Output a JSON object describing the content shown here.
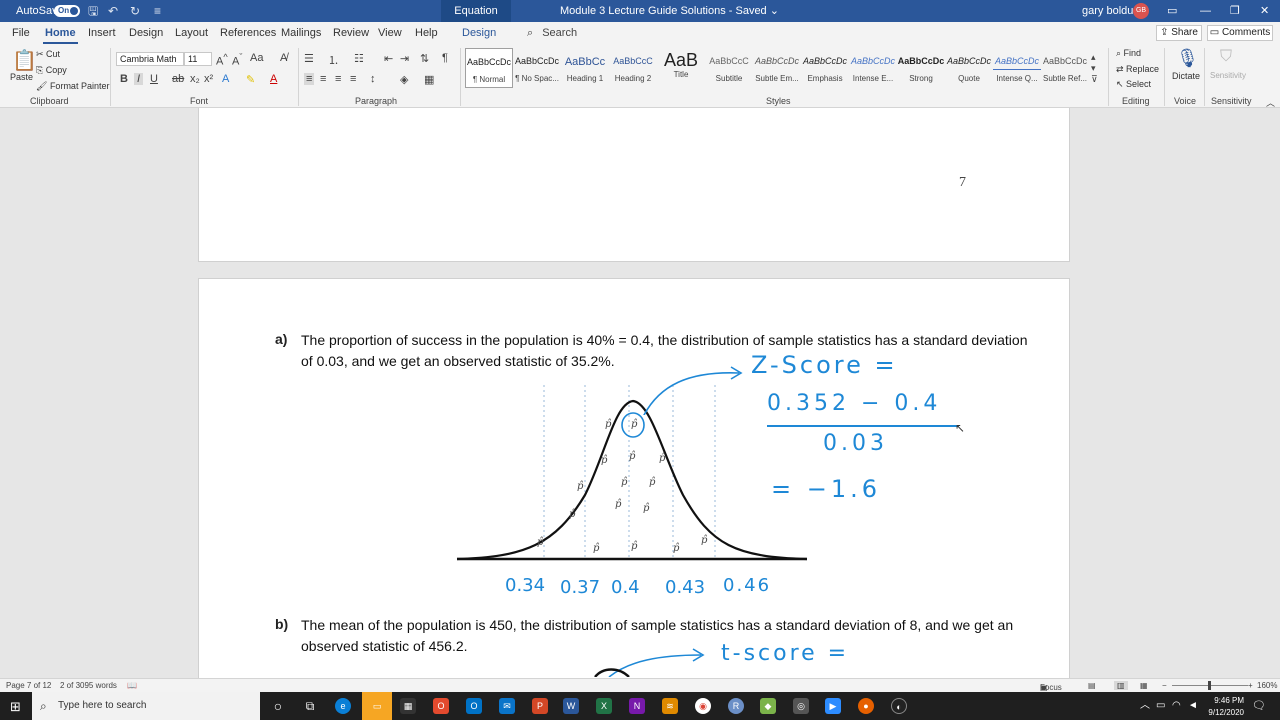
{
  "titlebar": {
    "autosave_label": "AutoSave",
    "autosave_state": "On",
    "contextual_tab": "Equation Tools",
    "doc_title": "Module 3 Lecture Guide Solutions  -  Saved  ⌄",
    "user_name": "gary bolduc",
    "user_initials": "GB"
  },
  "tabs": {
    "items": [
      "File",
      "Home",
      "Insert",
      "Design",
      "Layout",
      "References",
      "Mailings",
      "Review",
      "View",
      "Help"
    ],
    "contextual": "Design",
    "search_label": "Search",
    "share": "Share",
    "comments": "Comments"
  },
  "ribbon": {
    "clipboard": {
      "paste": "Paste",
      "cut": "Cut",
      "copy": "Copy",
      "format_painter": "Format Painter",
      "group_label": "Clipboard"
    },
    "font": {
      "font_name": "Cambria Math",
      "font_size": "11",
      "group_label": "Font"
    },
    "paragraph": {
      "group_label": "Paragraph"
    },
    "styles": {
      "group_label": "Styles",
      "items": [
        {
          "preview": "AaBbCcDc",
          "name": "¶ Normal"
        },
        {
          "preview": "AaBbCcDc",
          "name": "¶ No Spac..."
        },
        {
          "preview": "AaBbCc",
          "name": "Heading 1"
        },
        {
          "preview": "AaBbCcC",
          "name": "Heading 2"
        },
        {
          "preview": "AaB",
          "name": "Title"
        },
        {
          "preview": "AaBbCcC",
          "name": "Subtitle"
        },
        {
          "preview": "AaBbCcDc",
          "name": "Subtle Em..."
        },
        {
          "preview": "AaBbCcDc",
          "name": "Emphasis"
        },
        {
          "preview": "AaBbCcDc",
          "name": "Intense E..."
        },
        {
          "preview": "AaBbCcDc",
          "name": "Strong"
        },
        {
          "preview": "AaBbCcDc",
          "name": "Quote"
        },
        {
          "preview": "AaBbCcDc",
          "name": "Intense Q..."
        },
        {
          "preview": "AaBbCcDc",
          "name": "Subtle Ref..."
        }
      ]
    },
    "editing": {
      "find": "Find",
      "replace": "Replace",
      "select": "Select",
      "group_label": "Editing"
    },
    "voice": {
      "dictate": "Dictate",
      "group_label": "Voice"
    },
    "sensitivity": {
      "label": "Sensitivity",
      "group_label": "Sensitivity"
    }
  },
  "document": {
    "page_number": "7",
    "question_a": {
      "label": "a)",
      "text": "The proportion of success in the population is 40% = 0.4, the distribution of sample statistics has a standard deviation of 0.03, and we get an observed statistic of 35.2%."
    },
    "question_b": {
      "label": "b)",
      "text": "The mean of the population is 450, the distribution of sample statistics has a standard deviation of 8, and we get an observed statistic of 456.2."
    },
    "handwriting_a": {
      "z_label": "Z-Score =",
      "numerator": "0.352 − 0.4",
      "denominator": "0.03",
      "result": "= −1.6",
      "axis_labels": [
        "0.34",
        "0.37",
        "0.4",
        "0.43",
        "0.46"
      ],
      "phat": "p̂"
    },
    "handwriting_b": {
      "t_label": "t-score ="
    }
  },
  "statusbar": {
    "page": "Page 7 of 12",
    "words": "2 of 3095 words",
    "focus": "Focus",
    "zoom": "160%"
  },
  "taskbar": {
    "search_placeholder": "Type here to search",
    "time": "9:46 PM",
    "date": "9/12/2020"
  },
  "colors": {
    "word_blue": "#2b579a",
    "ink_blue": "#1e88d6"
  }
}
